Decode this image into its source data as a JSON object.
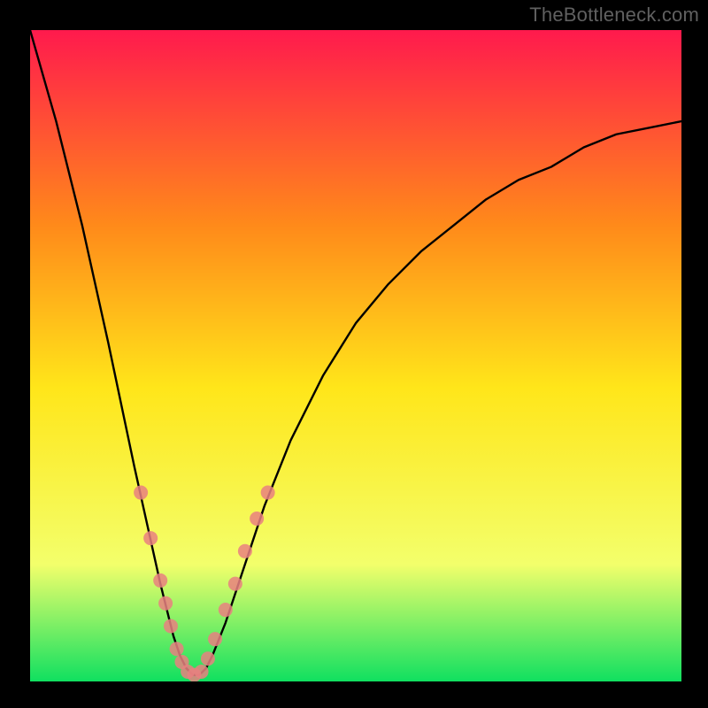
{
  "watermark": "TheBottleneck.com",
  "chart_data": {
    "type": "line",
    "title": "",
    "xlabel": "",
    "ylabel": "",
    "xlim": [
      0,
      100
    ],
    "ylim": [
      0,
      100
    ],
    "grid": false,
    "legend": false,
    "background_gradient": {
      "top": "#ff1a4d",
      "upper_mid": "#ff8a1a",
      "mid": "#ffe61a",
      "lower_mid": "#f3ff6b",
      "bottom": "#10e060"
    },
    "series": [
      {
        "name": "bottleneck-curve",
        "color": "#000000",
        "x": [
          0,
          4,
          8,
          12,
          16,
          18,
          20,
          21,
          22,
          23,
          24,
          25,
          26,
          27,
          28,
          30,
          32,
          34,
          36,
          40,
          45,
          50,
          55,
          60,
          65,
          70,
          75,
          80,
          85,
          90,
          95,
          100
        ],
        "y": [
          100,
          86,
          70,
          52,
          33,
          24,
          15,
          11,
          7,
          4,
          2,
          1,
          1,
          2,
          4,
          9,
          15,
          21,
          27,
          37,
          47,
          55,
          61,
          66,
          70,
          74,
          77,
          79,
          82,
          84,
          85,
          86
        ]
      }
    ],
    "markers": {
      "name": "highlight-dots",
      "color": "#e98080",
      "points": [
        {
          "x": 17,
          "y": 29
        },
        {
          "x": 18.5,
          "y": 22
        },
        {
          "x": 20,
          "y": 15.5
        },
        {
          "x": 20.8,
          "y": 12
        },
        {
          "x": 21.6,
          "y": 8.5
        },
        {
          "x": 22.5,
          "y": 5
        },
        {
          "x": 23.3,
          "y": 3
        },
        {
          "x": 24.2,
          "y": 1.5
        },
        {
          "x": 25.2,
          "y": 1
        },
        {
          "x": 26.3,
          "y": 1.5
        },
        {
          "x": 27.3,
          "y": 3.5
        },
        {
          "x": 28.4,
          "y": 6.5
        },
        {
          "x": 30,
          "y": 11
        },
        {
          "x": 31.5,
          "y": 15
        },
        {
          "x": 33,
          "y": 20
        },
        {
          "x": 34.8,
          "y": 25
        },
        {
          "x": 36.5,
          "y": 29
        }
      ]
    }
  }
}
